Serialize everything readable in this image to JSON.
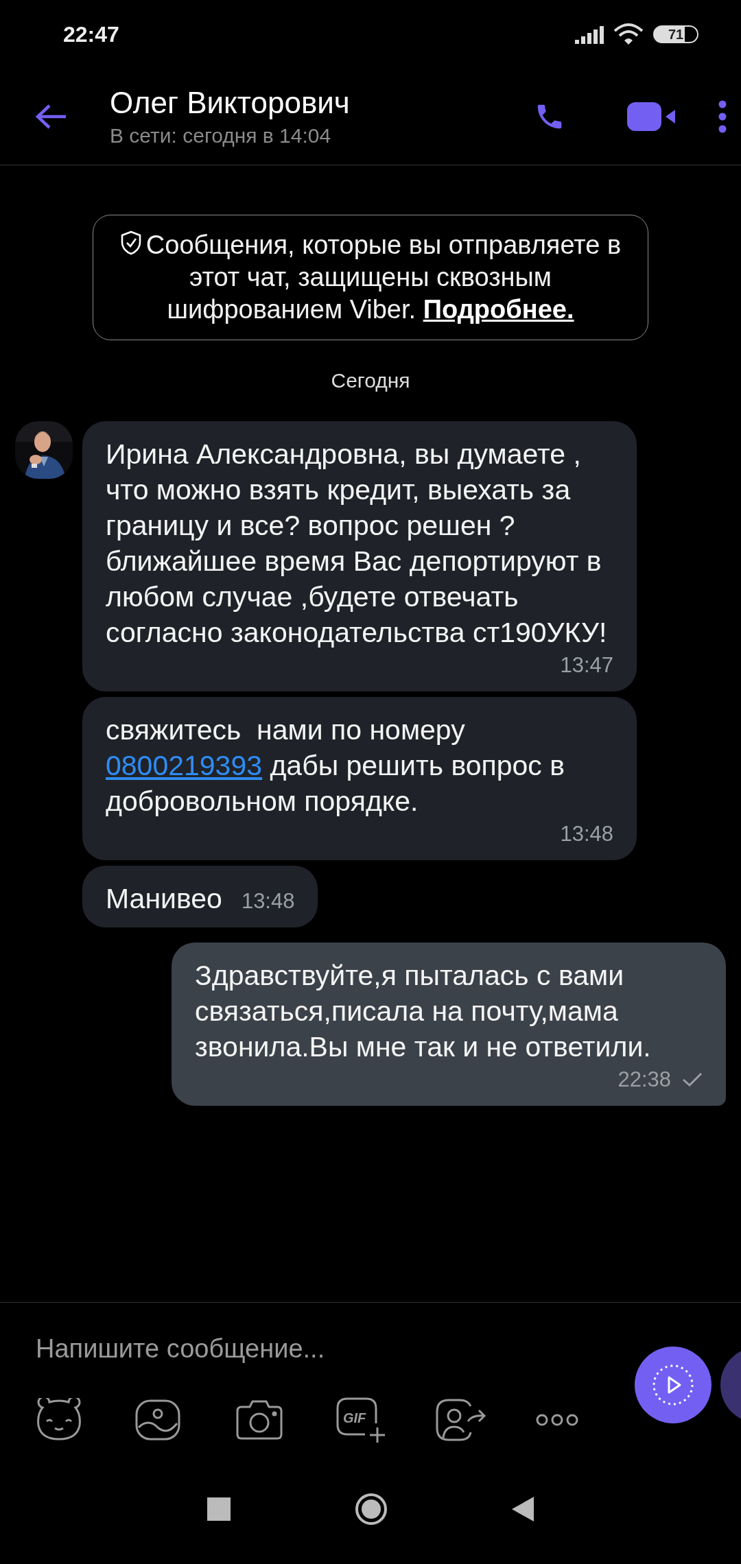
{
  "status_bar": {
    "time": "22:47",
    "battery": "71"
  },
  "header": {
    "title": "Олег Викторович",
    "subtitle": "В сети: сегодня в 14:04"
  },
  "notice": {
    "parts": [
      {
        "kind": "text",
        "text": "Сообщения, которые вы отправляете в этот чат, защищены сквозным шифрованием Viber. "
      },
      {
        "kind": "link",
        "text": "Подробнее."
      }
    ]
  },
  "date_divider": "Сегодня",
  "messages": [
    {
      "kind": "incoming",
      "avatar": {
        "kind": "picture"
      },
      "parts": [
        {
          "kind": "text",
          "text": "Ирина Александровна, вы думаете , что можно взять кредит, выехать за границу и все? вопрос решен ?ближайшее время Вас депортируют в любом случае ,будете отвечать согласно законодательства ст190УКУ!"
        }
      ],
      "time": "13:47",
      "delivered": false
    },
    {
      "kind": "incoming",
      "parts": [
        {
          "kind": "text",
          "text": "свяжитесь  нами по номеру "
        },
        {
          "kind": "link",
          "text": "0800219393"
        },
        {
          "kind": "text",
          "text": " дабы решить вопрос в добровольном порядке."
        }
      ],
      "time": "13:48",
      "delivered": false
    },
    {
      "kind": "incoming",
      "parts": [
        {
          "kind": "text",
          "text": "Манивео"
        }
      ],
      "time": "13:48",
      "delivered": false
    },
    {
      "kind": "outgoing",
      "parts": [
        {
          "kind": "text",
          "text": "Здравствуйте,я пыталась с вами связаться,писала на почту,мама звонила.Вы мне так и не ответили."
        }
      ],
      "time": "22:38",
      "delivered": true
    }
  ],
  "composer": {
    "placeholder": "Напишите сообщение...",
    "gif_label": "GIF"
  }
}
